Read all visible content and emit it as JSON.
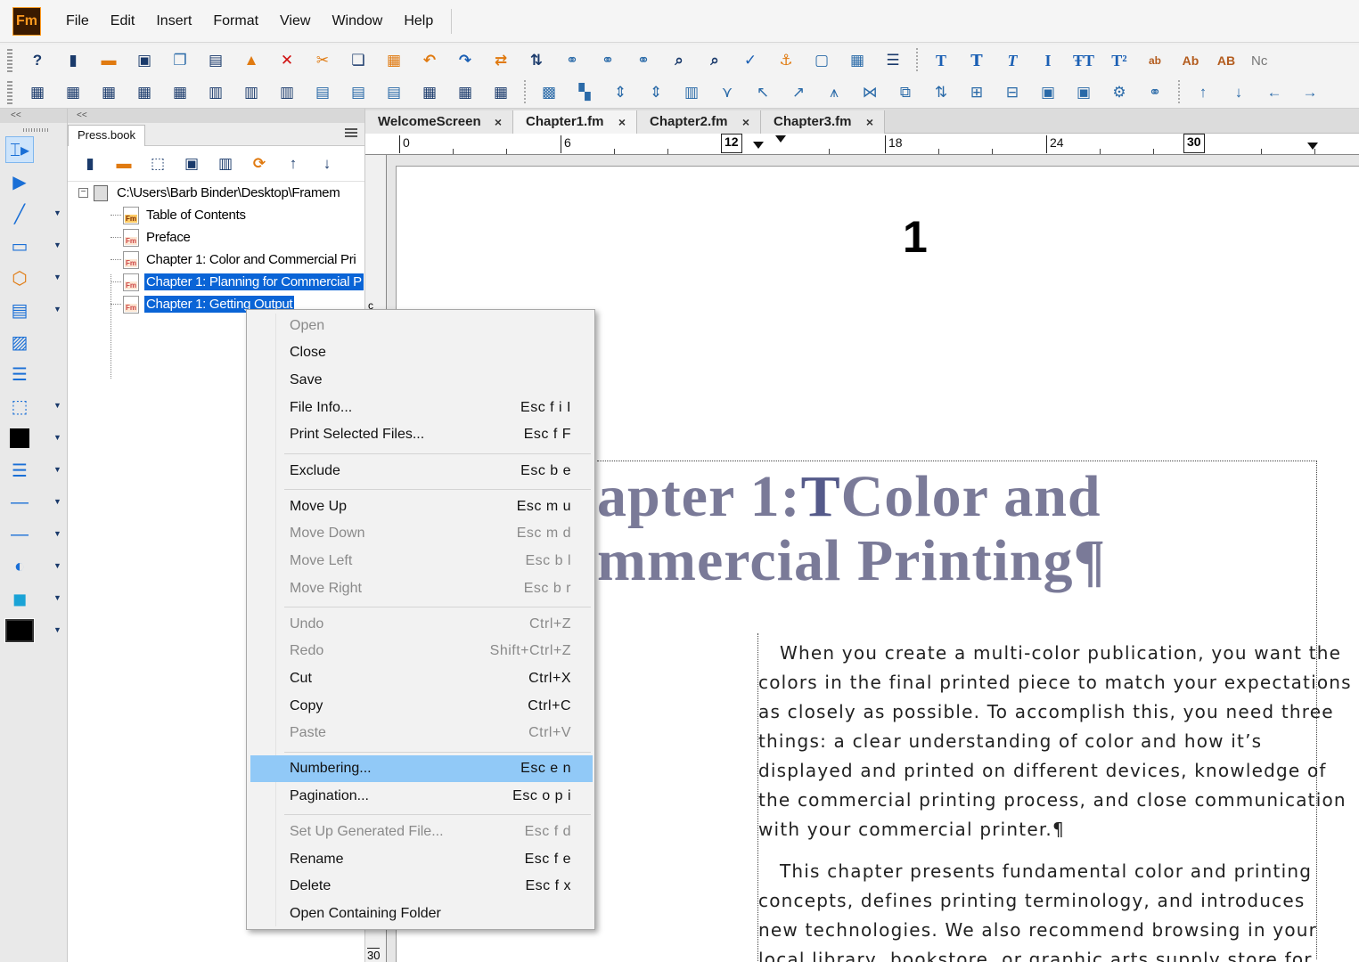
{
  "app": {
    "logo": "Fm"
  },
  "menubar": {
    "items": [
      "File",
      "Edit",
      "Insert",
      "Format",
      "View",
      "Window",
      "Help"
    ]
  },
  "toolbar1": {
    "icons": [
      "help-icon",
      "new-icon",
      "open-icon",
      "save-icon",
      "save-all-icon",
      "print-icon",
      "lock-icon",
      "delete-icon",
      "cut-icon",
      "copy-icon",
      "paste-icon",
      "undo-icon",
      "redo-icon",
      "repeat-icon",
      "link-icon",
      "ref-icon",
      "var-icon",
      "index-icon",
      "find-icon",
      "zoom-icon",
      "spell-icon",
      "anchor-icon",
      "frame-icon",
      "table-icon",
      "list-icon",
      "text-plain-icon",
      "text-bold-icon",
      "text-italic-icon",
      "text-serif-icon",
      "text-super-icon",
      "text-sub-icon",
      "text-small-icon",
      "text-ab-icon",
      "text-AB-icon"
    ],
    "text_labels": {
      "small": "ab",
      "ab": "Ab",
      "AB": "AB"
    },
    "cut_text": "Nc"
  },
  "toolbar2": {
    "icons": [
      "table-1-icon",
      "table-2-icon",
      "table-3-icon",
      "table-4-icon",
      "table-5-icon",
      "table-6-icon",
      "table-7-icon",
      "table-8-icon",
      "table-9-icon",
      "table-10-icon",
      "table-11-icon",
      "table-12-icon",
      "table-13-icon",
      "table-14-icon",
      "align-1-icon",
      "align-2-icon",
      "align-3-icon",
      "align-4-icon",
      "align-5-icon",
      "align-6-icon",
      "align-7-icon",
      "align-8-icon",
      "align-9-icon",
      "align-10-icon",
      "align-11-icon",
      "align-12-icon",
      "align-13-icon",
      "align-14-icon",
      "align-15-icon",
      "align-16-icon",
      "align-17-icon",
      "align-18-icon",
      "arrow-up-icon",
      "arrow-down-icon",
      "arrow-left-icon",
      "arrow-right-icon"
    ]
  },
  "toolbox": {
    "header": "<<",
    "tools": [
      "text-select-icon",
      "object-select-icon",
      "line-tool-icon",
      "rectangle-tool-icon",
      "polygon-tool-icon",
      "text-frame-icon",
      "graphic-icon",
      "flow-icon",
      "marquee-icon",
      "fill-icon",
      "line-width-icon",
      "line-style-icon",
      "dash-icon",
      "tint-icon",
      "overprint-icon",
      "color-icon"
    ]
  },
  "book_panel": {
    "header": "<<",
    "tab_label": "Press.book",
    "tree": {
      "root_path": "C:\\Users\\Barb Binder\\Desktop\\Framem",
      "items": [
        {
          "label": "Table of Contents",
          "selected": false
        },
        {
          "label": "Preface",
          "selected": false
        },
        {
          "label": "Chapter 1: Color and Commercial Pri",
          "selected": false
        },
        {
          "label": "Chapter 1: Planning for Commercial P",
          "selected": true
        },
        {
          "label": "Chapter 1: Getting Output",
          "selected": true
        }
      ]
    }
  },
  "doc_tabs": [
    {
      "label": "WelcomeScreen",
      "close": "×"
    },
    {
      "label": "Chapter1.fm",
      "close": "×"
    },
    {
      "label": "Chapter2.fm",
      "close": "×"
    },
    {
      "label": "Chapter3.fm",
      "close": "×"
    }
  ],
  "ruler": {
    "labels": [
      "0",
      "6",
      "12",
      "18",
      "24",
      "30"
    ],
    "vertical_labels": [
      "c",
      "30"
    ]
  },
  "page": {
    "page_number": "1",
    "chapter_title": {
      "line1_pre": "apter 1:",
      "cursor": "T",
      "line1_post": "Color and",
      "line2": "mmercial Printing¶"
    },
    "para1": [
      "When you create a multi-color publication, you want the",
      "colors in the final printed piece to match your expectations",
      "as closely as possible. To accomplish this, you need three",
      "things: a clear understanding of color and how it’s",
      "displayed and printed on different devices, knowledge of",
      "the commercial printing process, and close communication",
      "with your commercial printer.¶"
    ],
    "para2": [
      "This chapter presents fundamental color and printing",
      "concepts, defines printing terminology, and introduces",
      "new technologies. We also recommend browsing in your",
      "local library, bookstore, or graphic arts supply store for"
    ]
  },
  "context_menu": {
    "items": [
      {
        "label": "Open",
        "shortcut": "",
        "disabled": true
      },
      {
        "label": "Close",
        "shortcut": "",
        "disabled": false
      },
      {
        "label": "Save",
        "shortcut": "",
        "disabled": false
      },
      {
        "label": "File Info...",
        "shortcut": "Esc f i I",
        "disabled": false
      },
      {
        "label": "Print Selected Files...",
        "shortcut": "Esc f F",
        "disabled": false
      },
      {
        "label": "Exclude",
        "shortcut": "Esc b e",
        "disabled": false
      },
      {
        "label": "Move Up",
        "shortcut": "Esc m u",
        "disabled": false
      },
      {
        "label": "Move Down",
        "shortcut": "Esc m d",
        "disabled": true
      },
      {
        "label": "Move Left",
        "shortcut": "Esc b l",
        "disabled": true
      },
      {
        "label": "Move Right",
        "shortcut": "Esc b r",
        "disabled": true
      },
      {
        "label": "Undo",
        "shortcut": "Ctrl+Z",
        "disabled": true
      },
      {
        "label": "Redo",
        "shortcut": "Shift+Ctrl+Z",
        "disabled": true
      },
      {
        "label": "Cut",
        "shortcut": "Ctrl+X",
        "disabled": false
      },
      {
        "label": "Copy",
        "shortcut": "Ctrl+C",
        "disabled": false
      },
      {
        "label": "Paste",
        "shortcut": "Ctrl+V",
        "disabled": true
      },
      {
        "label": "Numbering...",
        "shortcut": "Esc e n",
        "disabled": false,
        "highlighted": true
      },
      {
        "label": "Pagination...",
        "shortcut": "Esc o p i",
        "disabled": false
      },
      {
        "label": "Set Up Generated File...",
        "shortcut": "Esc f d",
        "disabled": true
      },
      {
        "label": "Rename",
        "shortcut": "Esc f e",
        "disabled": false
      },
      {
        "label": "Delete",
        "shortcut": "Esc f x",
        "disabled": false
      },
      {
        "label": "Open Containing Folder",
        "shortcut": "",
        "disabled": false
      }
    ]
  },
  "colors": {
    "selection": "#0a64d6",
    "menu_highlight": "#91c9f7",
    "title_text": "#7a7a98",
    "logo_orange": "#ff9a1f"
  }
}
